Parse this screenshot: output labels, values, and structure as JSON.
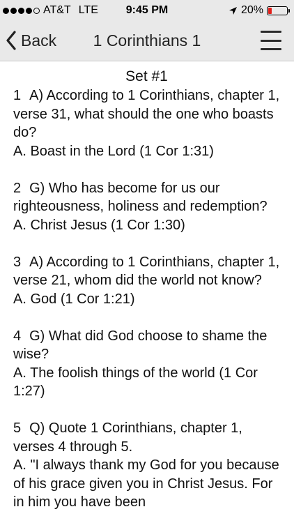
{
  "status_bar": {
    "carrier": "AT&T",
    "network": "LTE",
    "time": "9:45 PM",
    "battery_percent": "20%",
    "battery_level": 0.2,
    "battery_color": "#e2201b",
    "location_icon": "location-arrow-icon"
  },
  "nav": {
    "back_label": "Back",
    "back_icon": "chevron-left-icon",
    "title": "1 Corinthians 1",
    "menu_icon": "hamburger-menu-icon"
  },
  "content": {
    "set_title": "Set #1",
    "items": [
      {
        "number": "1",
        "question": "A) According to 1 Corinthians, chapter 1, verse 31, what should the one who boasts do?",
        "answer": "A. Boast in the Lord (1 Cor 1:31)"
      },
      {
        "number": "2",
        "question": "G) Who has become for us our righteousness, holiness and redemption?",
        "answer": "A. Christ Jesus (1 Cor 1:30)"
      },
      {
        "number": "3",
        "question": "A) According to 1 Corinthians, chapter 1, verse 21, whom did the world not know?",
        "answer": "A. God (1 Cor 1:21)"
      },
      {
        "number": "4",
        "question": "G) What did God choose to shame the wise?",
        "answer": "A. The foolish things of the world (1 Cor 1:27)"
      },
      {
        "number": "5",
        "question": "Q) Quote 1 Corinthians, chapter 1, verses 4 through 5.",
        "answer": "A. \"I always thank my God for you because of his grace given you in Christ Jesus. For in him you have been"
      }
    ]
  }
}
